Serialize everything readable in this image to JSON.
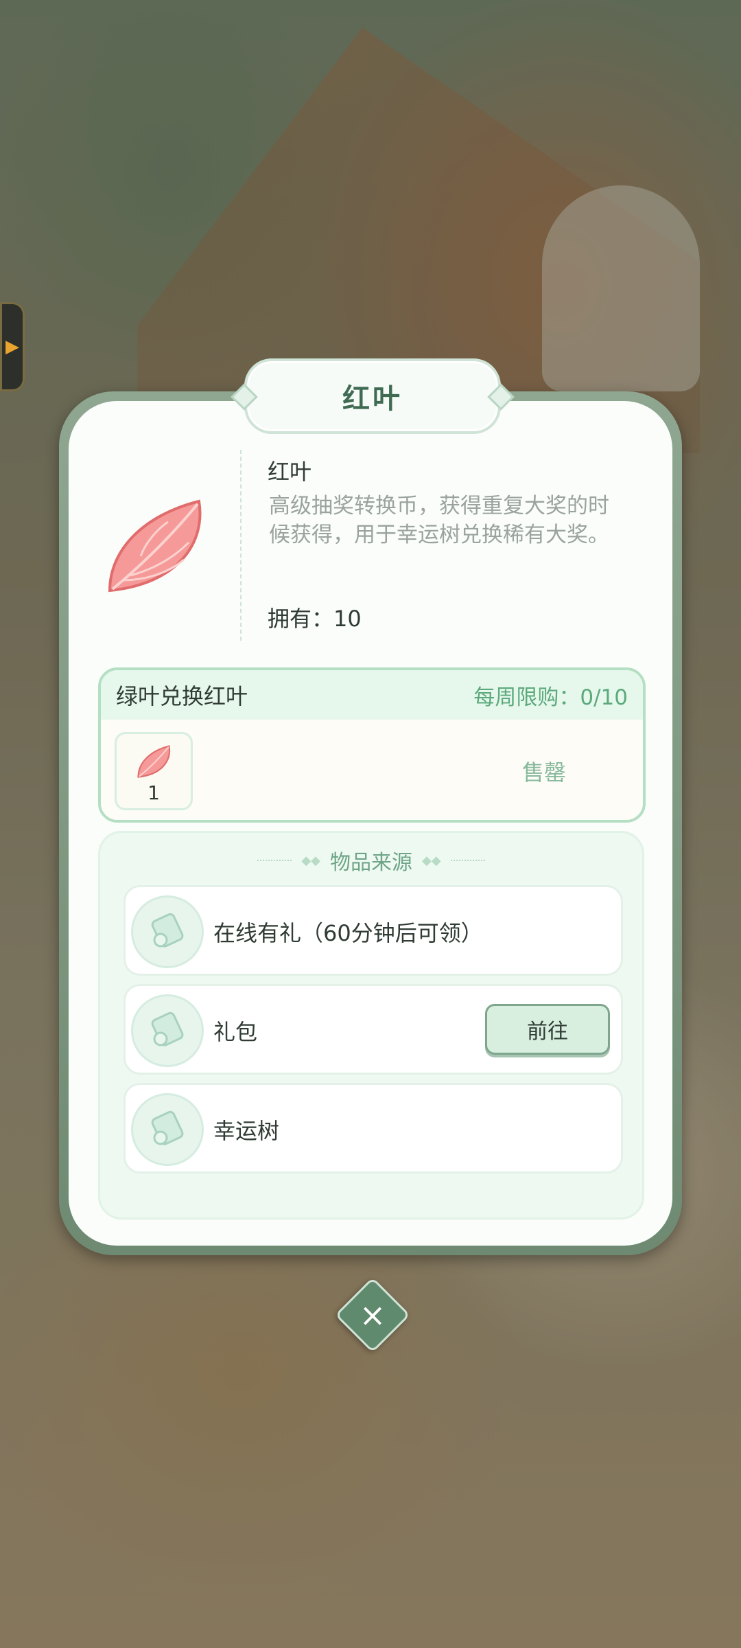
{
  "side_tab": {
    "icon": "chevron-right-icon"
  },
  "dialog": {
    "title": "红叶",
    "item": {
      "name": "红叶",
      "description": "高级抽奖转换币，获得重复大奖的时候获得，用于幸运树兑换稀有大奖。",
      "owned": "拥有：10",
      "icon": "red-leaf-icon"
    },
    "exchange": {
      "title": "绿叶兑换红叶",
      "weekly_limit": "每周限购：0/10",
      "slot_count": "1",
      "status": "售罄"
    },
    "sources": {
      "title": "物品来源",
      "items": [
        {
          "label": "在线有礼（60分钟后可领）",
          "icon": "scroll-icon"
        },
        {
          "label": "礼包",
          "icon": "scroll-icon",
          "button": "前往"
        },
        {
          "label": "幸运树",
          "icon": "scroll-icon"
        }
      ]
    },
    "close_icon": "close-icon"
  },
  "colors": {
    "accent_green": "#5caa7c",
    "title_green": "#3f6b53",
    "frame_green": "#6f8a72",
    "leaf_red": "#f07f80"
  }
}
